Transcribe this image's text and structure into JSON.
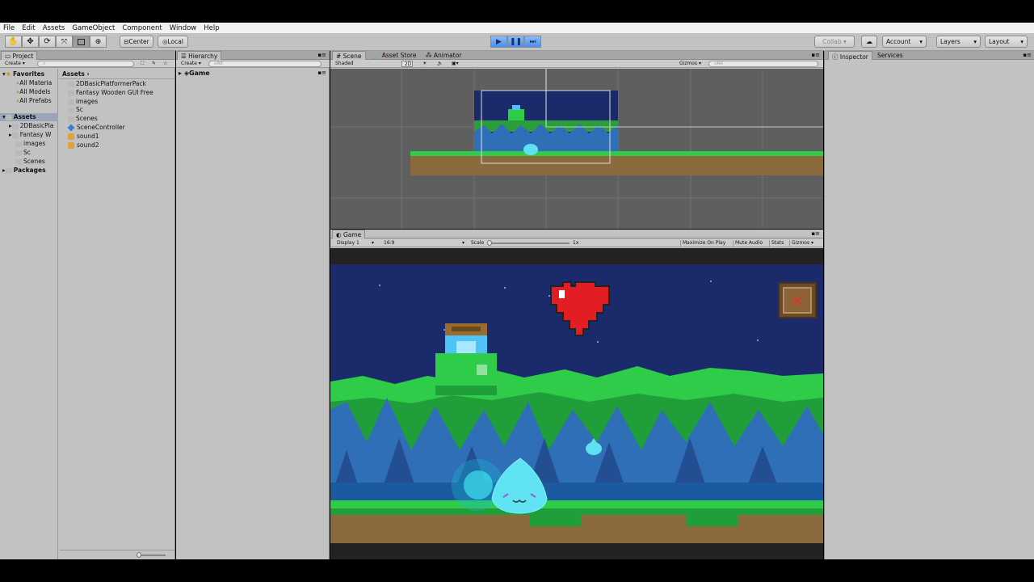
{
  "menu": [
    "File",
    "Edit",
    "Assets",
    "GameObject",
    "Component",
    "Window",
    "Help"
  ],
  "toolbar": {
    "pivot": "Center",
    "space": "Local",
    "collab": "Collab ▾",
    "account": "Account",
    "layers": "Layers",
    "layout": "Layout"
  },
  "project": {
    "tab": "Project",
    "create": "Create ▾",
    "favorites_label": "Favorites",
    "favorites": [
      "All Materia",
      "All Models",
      "All Prefabs"
    ],
    "assets_label": "Assets",
    "tree": [
      "2DBasicPla",
      "Fantasy W",
      "images",
      "Sc",
      "Scenes"
    ],
    "packages_label": "Packages",
    "breadcrumb": "Assets",
    "files": [
      "2DBasicPlatformerPack",
      "Fantasy Wooden GUI  Free",
      "images",
      "Sc",
      "Scenes",
      "SceneController",
      "sound1",
      "sound2"
    ]
  },
  "hierarchy": {
    "tab": "Hierarchy",
    "create": "Create ▾",
    "search_placeholder": "All",
    "root": "Game"
  },
  "scene": {
    "tabs": [
      "Scene",
      "Asset Store",
      "Animator"
    ],
    "shading": "Shaded",
    "mode_2d": "2D",
    "gizmos": "Gizmos ▾",
    "search_placeholder": "All"
  },
  "game": {
    "tab": "Game",
    "display": "Display 1",
    "aspect": "16:9",
    "scale_label": "Scale",
    "scale_value": "1x",
    "options": [
      "Maximize On Play",
      "Mute Audio",
      "Stats",
      "Gizmos ▾"
    ]
  },
  "inspector": {
    "tabs": [
      "Inspector",
      "Services"
    ]
  },
  "colors": {
    "editor_bg": "#c2c2c2",
    "sky": "#1b2a6b",
    "grass": "#2fcc4a",
    "ground": "#8b6a3e",
    "play_blue": "#4a8df0"
  }
}
